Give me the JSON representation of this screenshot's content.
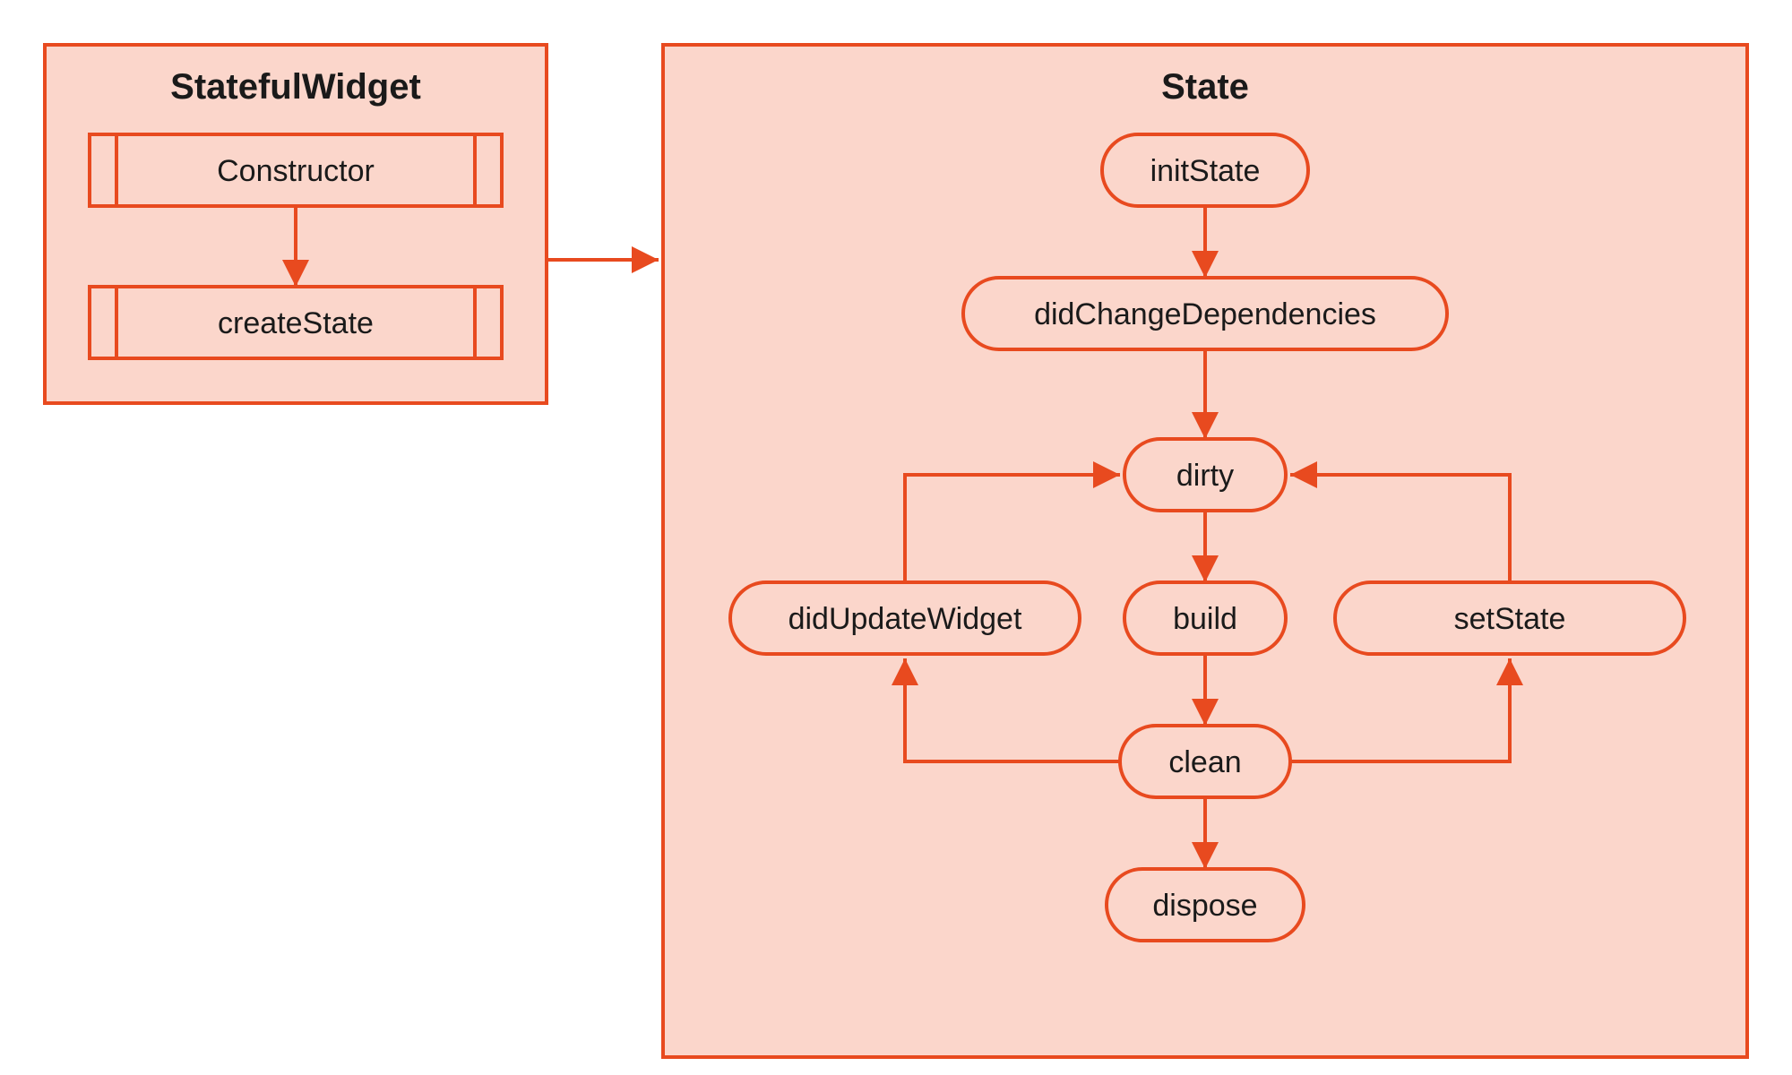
{
  "colors": {
    "stroke": "#e84a1f",
    "fill": "#fbd6cb",
    "text": "#1a1a1a"
  },
  "panels": {
    "stateful": {
      "title": "StatefulWidget"
    },
    "state": {
      "title": "State"
    }
  },
  "nodes": {
    "constructor": {
      "label": "Constructor"
    },
    "createState": {
      "label": "createState"
    },
    "initState": {
      "label": "initState"
    },
    "didChangeDependencies": {
      "label": "didChangeDependencies"
    },
    "dirty": {
      "label": "dirty"
    },
    "didUpdateWidget": {
      "label": "didUpdateWidget"
    },
    "build": {
      "label": "build"
    },
    "setState": {
      "label": "setState"
    },
    "clean": {
      "label": "clean"
    },
    "dispose": {
      "label": "dispose"
    }
  },
  "edges_description": [
    "Constructor -> createState",
    "createState panel -> State panel",
    "initState -> didChangeDependencies",
    "didChangeDependencies -> dirty",
    "dirty -> build",
    "build -> clean",
    "clean -> dispose",
    "didUpdateWidget -> dirty",
    "setState -> dirty",
    "clean -> didUpdateWidget",
    "clean -> setState"
  ]
}
